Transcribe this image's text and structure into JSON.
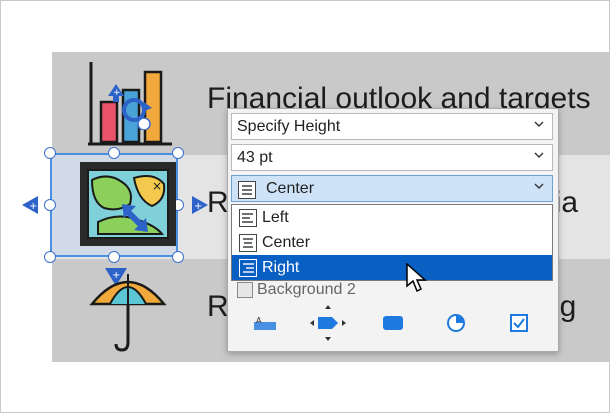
{
  "rows": [
    {
      "text": "Financial outlook and targets"
    },
    {
      "text": "R"
    },
    {
      "text": "R"
    }
  ],
  "right_fragments": [
    "entia",
    "mitig"
  ],
  "panel": {
    "mode_select": "Specify Height",
    "height_value": "43 pt",
    "align_select": "Center",
    "align_options": [
      "Left",
      "Center",
      "Right"
    ],
    "selected_option": "Right",
    "hidden_field": "Background 2"
  },
  "colors": {
    "accent": "#0a60c2",
    "selection": "#4a90e2",
    "slide_bg": "#c9c9c9"
  }
}
